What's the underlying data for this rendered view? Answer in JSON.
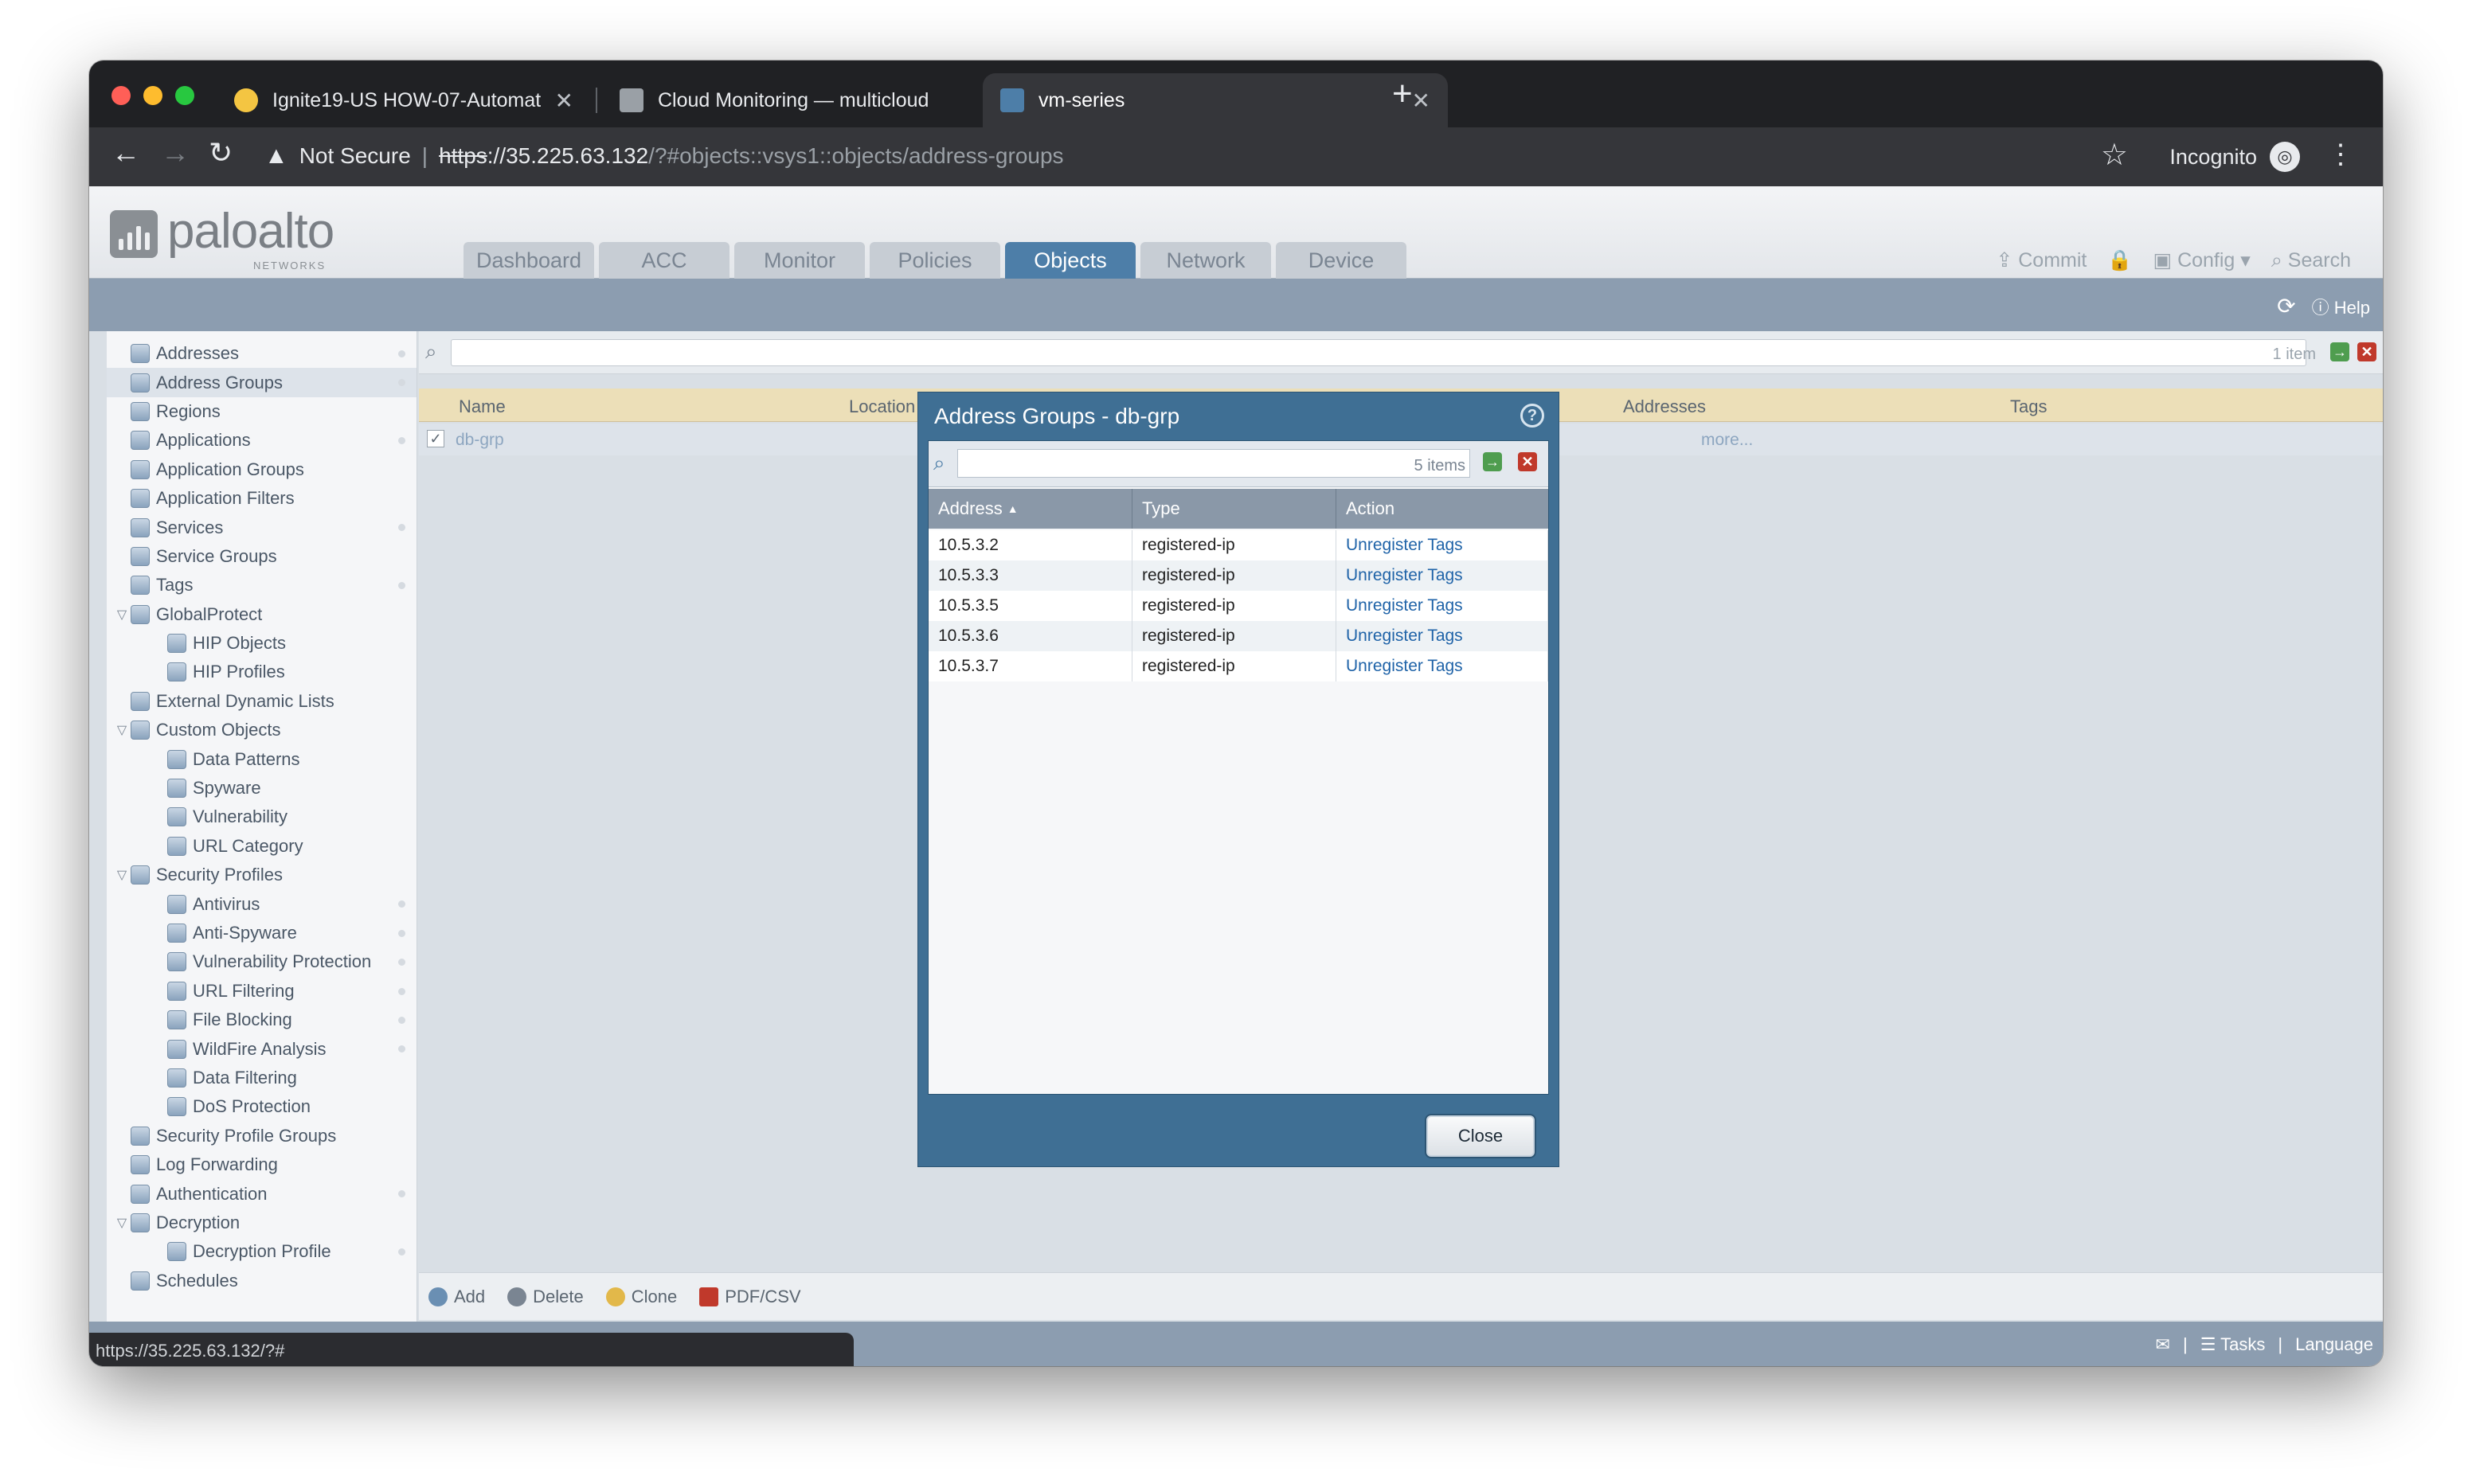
{
  "browser": {
    "tabs": [
      {
        "title": "Ignite19-US HOW-07-Automat",
        "active": false
      },
      {
        "title": "Cloud Monitoring — multicloud",
        "active": false
      },
      {
        "title": "vm-series",
        "active": true
      }
    ],
    "security_label": "Not Secure",
    "url_scheme": "https",
    "url_rest": "://35.225.63.132",
    "url_path": "/?#objects::vsys1::objects/address-groups",
    "profile": "Incognito",
    "status_url": "https://35.225.63.132/?#"
  },
  "app": {
    "brand": "paloalto",
    "brand_sub": "NETWORKS",
    "main_tabs": [
      "Dashboard",
      "ACC",
      "Monitor",
      "Policies",
      "Objects",
      "Network",
      "Device"
    ],
    "header_actions": {
      "commit": "Commit",
      "config": "Config",
      "search": "Search"
    },
    "help": "Help",
    "sidebar": [
      {
        "label": "Addresses",
        "indent": 0,
        "dot": true
      },
      {
        "label": "Address Groups",
        "indent": 0,
        "dot": true,
        "selected": true
      },
      {
        "label": "Regions",
        "indent": 0
      },
      {
        "label": "Applications",
        "indent": 0,
        "dot": true
      },
      {
        "label": "Application Groups",
        "indent": 0
      },
      {
        "label": "Application Filters",
        "indent": 0
      },
      {
        "label": "Services",
        "indent": 0,
        "dot": true
      },
      {
        "label": "Service Groups",
        "indent": 0
      },
      {
        "label": "Tags",
        "indent": 0,
        "dot": true
      },
      {
        "label": "GlobalProtect",
        "indent": 0,
        "expanded": true
      },
      {
        "label": "HIP Objects",
        "indent": 1
      },
      {
        "label": "HIP Profiles",
        "indent": 1
      },
      {
        "label": "External Dynamic Lists",
        "indent": 0
      },
      {
        "label": "Custom Objects",
        "indent": 0,
        "expanded": true
      },
      {
        "label": "Data Patterns",
        "indent": 1
      },
      {
        "label": "Spyware",
        "indent": 1
      },
      {
        "label": "Vulnerability",
        "indent": 1
      },
      {
        "label": "URL Category",
        "indent": 1
      },
      {
        "label": "Security Profiles",
        "indent": 0,
        "expanded": true
      },
      {
        "label": "Antivirus",
        "indent": 1,
        "dot": true
      },
      {
        "label": "Anti-Spyware",
        "indent": 1,
        "dot": true
      },
      {
        "label": "Vulnerability Protection",
        "indent": 1,
        "dot": true
      },
      {
        "label": "URL Filtering",
        "indent": 1,
        "dot": true
      },
      {
        "label": "File Blocking",
        "indent": 1,
        "dot": true
      },
      {
        "label": "WildFire Analysis",
        "indent": 1,
        "dot": true
      },
      {
        "label": "Data Filtering",
        "indent": 1
      },
      {
        "label": "DoS Protection",
        "indent": 1
      },
      {
        "label": "Security Profile Groups",
        "indent": 0
      },
      {
        "label": "Log Forwarding",
        "indent": 0
      },
      {
        "label": "Authentication",
        "indent": 0,
        "dot": true
      },
      {
        "label": "Decryption",
        "indent": 0,
        "expanded": true
      },
      {
        "label": "Decryption Profile",
        "indent": 1,
        "dot": true
      },
      {
        "label": "Schedules",
        "indent": 0
      }
    ],
    "grid": {
      "item_count": "1 item",
      "columns": {
        "name": "Name",
        "location": "Location",
        "addresses": "Addresses",
        "tags": "Tags"
      },
      "row": {
        "name": "db-grp",
        "addresses": "more..."
      }
    },
    "bottom_actions": [
      "Add",
      "Delete",
      "Clone",
      "PDF/CSV"
    ],
    "status_right": [
      "Tasks",
      "Language"
    ]
  },
  "dialog": {
    "title": "Address Groups - db-grp",
    "count": "5 items",
    "columns": [
      "Address",
      "Type",
      "Action"
    ],
    "rows": [
      {
        "address": "10.5.3.2",
        "type": "registered-ip",
        "action": "Unregister Tags"
      },
      {
        "address": "10.5.3.3",
        "type": "registered-ip",
        "action": "Unregister Tags"
      },
      {
        "address": "10.5.3.5",
        "type": "registered-ip",
        "action": "Unregister Tags"
      },
      {
        "address": "10.5.3.6",
        "type": "registered-ip",
        "action": "Unregister Tags"
      },
      {
        "address": "10.5.3.7",
        "type": "registered-ip",
        "action": "Unregister Tags"
      }
    ],
    "close_label": "Close"
  },
  "colors": {
    "accent": "#4d7ea8",
    "dialog": "#3f6f94",
    "link": "#1f63a8"
  }
}
